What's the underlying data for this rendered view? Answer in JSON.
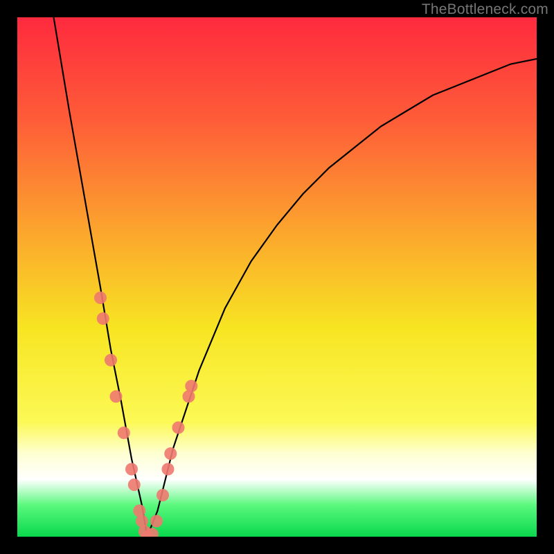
{
  "watermark": "TheBottleneck.com",
  "colors": {
    "dot": "#ee796f",
    "curve": "#000000",
    "frame": "#000000"
  },
  "chart_data": {
    "type": "line",
    "title": "",
    "xlabel": "",
    "ylabel": "",
    "xlim": [
      0,
      100
    ],
    "ylim": [
      0,
      100
    ],
    "grid": false,
    "legend_position": "none",
    "series": [
      {
        "name": "bottleneck-curve",
        "x": [
          7,
          10,
          13,
          16,
          18,
          20,
          22,
          24,
          25,
          27,
          30,
          35,
          40,
          45,
          50,
          55,
          60,
          65,
          70,
          75,
          80,
          85,
          90,
          95,
          100
        ],
        "y": [
          100,
          82,
          65,
          48,
          36,
          26,
          15,
          6,
          0,
          5,
          17,
          32,
          44,
          53,
          60,
          66,
          71,
          75,
          79,
          82,
          85,
          87,
          89,
          91,
          92
        ]
      }
    ],
    "annotations": [
      {
        "name": "highlighted-dots",
        "points_xy": [
          [
            16,
            46
          ],
          [
            16.5,
            42
          ],
          [
            18,
            34
          ],
          [
            19,
            27
          ],
          [
            20.5,
            20
          ],
          [
            22,
            13
          ],
          [
            22.5,
            10
          ],
          [
            23.5,
            5
          ],
          [
            24,
            3
          ],
          [
            24.5,
            1
          ],
          [
            25,
            0
          ],
          [
            26,
            0.5
          ],
          [
            26.8,
            3
          ],
          [
            28,
            8
          ],
          [
            29,
            13
          ],
          [
            29.5,
            16
          ],
          [
            31,
            21
          ],
          [
            33,
            27
          ],
          [
            33.5,
            29
          ]
        ]
      }
    ]
  }
}
